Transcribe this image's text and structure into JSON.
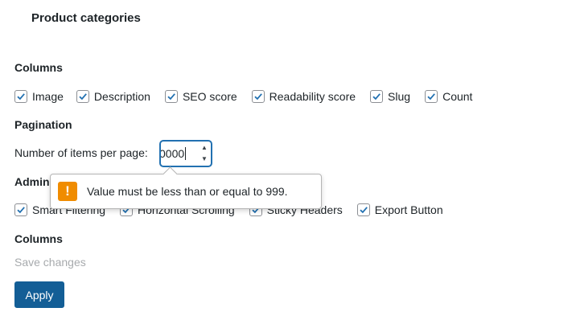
{
  "panel_title": "Product categories",
  "columns_section": {
    "title": "Columns",
    "options": [
      {
        "label": "Image",
        "checked": true
      },
      {
        "label": "Description",
        "checked": true
      },
      {
        "label": "SEO score",
        "checked": true
      },
      {
        "label": "Readability score",
        "checked": true
      },
      {
        "label": "Slug",
        "checked": true
      },
      {
        "label": "Count",
        "checked": true
      }
    ]
  },
  "pagination_section": {
    "title": "Pagination",
    "items_per_page_label": "Number of items per page:",
    "items_per_page_value": "0000"
  },
  "admin_section": {
    "title_visible": "Admin",
    "options": [
      {
        "label": "Smart Filtering",
        "checked": true
      },
      {
        "label": "Horizontal Scrolling",
        "checked": true
      },
      {
        "label": "Sticky Headers",
        "checked": true
      },
      {
        "label": "Export Button",
        "checked": true
      }
    ]
  },
  "columns_section_2": {
    "title": "Columns"
  },
  "save_changes_text": "Save changes",
  "apply_button_label": "Apply",
  "validation_tooltip": {
    "icon_glyph": "!",
    "message": "Value must be less than or equal to 999."
  },
  "colors": {
    "accent": "#2271b1",
    "button": "#135e96",
    "warning": "#f08c00",
    "muted": "#a7aaad"
  }
}
